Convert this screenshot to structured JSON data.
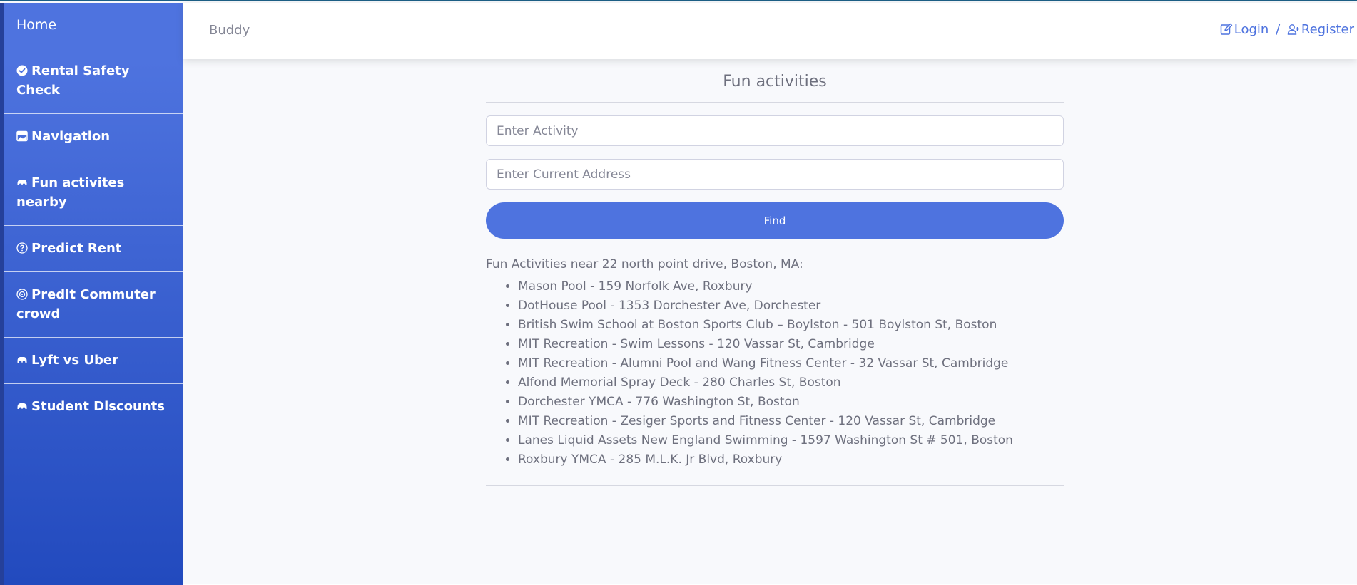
{
  "sidebar": {
    "home_label": "Home",
    "items": [
      {
        "label": "Rental Safety Check",
        "icon": "check-circle-icon"
      },
      {
        "label": "Navigation",
        "icon": "image-icon"
      },
      {
        "label": "Fun activites nearby",
        "icon": "car-icon"
      },
      {
        "label": "Predict Rent",
        "icon": "question-circle-icon"
      },
      {
        "label": "Predit Commuter crowd",
        "icon": "bullseye-icon"
      },
      {
        "label": "Lyft vs Uber",
        "icon": "car-icon"
      },
      {
        "label": "Student Discounts",
        "icon": "car-icon"
      }
    ]
  },
  "topbar": {
    "brand": "Buddy",
    "login_label": "Login",
    "separator": "/",
    "register_label": "Register"
  },
  "main": {
    "title": "Fun activities",
    "activity_placeholder": "Enter Activity",
    "address_placeholder": "Enter Current Address",
    "find_label": "Find",
    "results_heading": "Fun Activities near 22 north point drive, Boston, MA:",
    "results": [
      "Mason Pool - 159 Norfolk Ave, Roxbury",
      "DotHouse Pool - 1353 Dorchester Ave, Dorchester",
      "British Swim School at Boston Sports Club – Boylston - 501 Boylston St, Boston",
      "MIT Recreation - Swim Lessons - 120 Vassar St, Cambridge",
      "MIT Recreation - Alumni Pool and Wang Fitness Center - 32 Vassar St, Cambridge",
      "Alfond Memorial Spray Deck - 280 Charles St, Boston",
      "Dorchester YMCA - 776 Washington St, Boston",
      "MIT Recreation - Zesiger Sports and Fitness Center - 120 Vassar St, Cambridge",
      "Lanes Liquid Assets New England Swimming - 1597 Washington St # 501, Boston",
      "Roxbury YMCA - 285 M.L.K. Jr Blvd, Roxbury"
    ]
  },
  "colors": {
    "primary": "#4e73df",
    "sidebar_gradient_end": "#224abe",
    "text_muted": "#858796",
    "background": "#f8f9fc"
  }
}
